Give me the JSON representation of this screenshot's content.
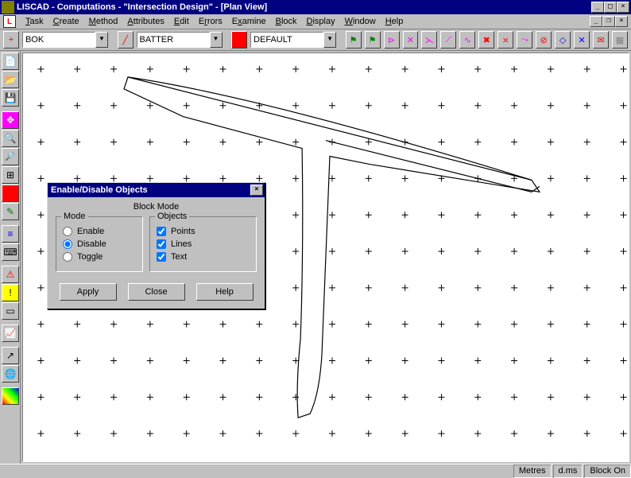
{
  "title": "LISCAD - Computations - \"Intersection Design\" - [Plan View]",
  "menu": [
    "Task",
    "Create",
    "Method",
    "Attributes",
    "Edit",
    "Errors",
    "Examine",
    "Block",
    "Display",
    "Window",
    "Help"
  ],
  "toolbar": {
    "combo1": "BOK",
    "combo2": "BATTER",
    "combo3": "DEFAULT"
  },
  "dialog": {
    "title": "Enable/Disable Objects",
    "heading": "Block Mode",
    "mode_legend": "Mode",
    "mode_options": {
      "enable": "Enable",
      "disable": "Disable",
      "toggle": "Toggle"
    },
    "objects_legend": "Objects",
    "objects_options": {
      "points": "Points",
      "lines": "Lines",
      "text": "Text"
    },
    "buttons": {
      "apply": "Apply",
      "close": "Close",
      "help": "Help"
    }
  },
  "status": {
    "metres": "Metres",
    "dms": "d.ms",
    "block": "Block On"
  },
  "colors": {
    "titlebar": "#000080",
    "panel": "#c0c0c0"
  }
}
